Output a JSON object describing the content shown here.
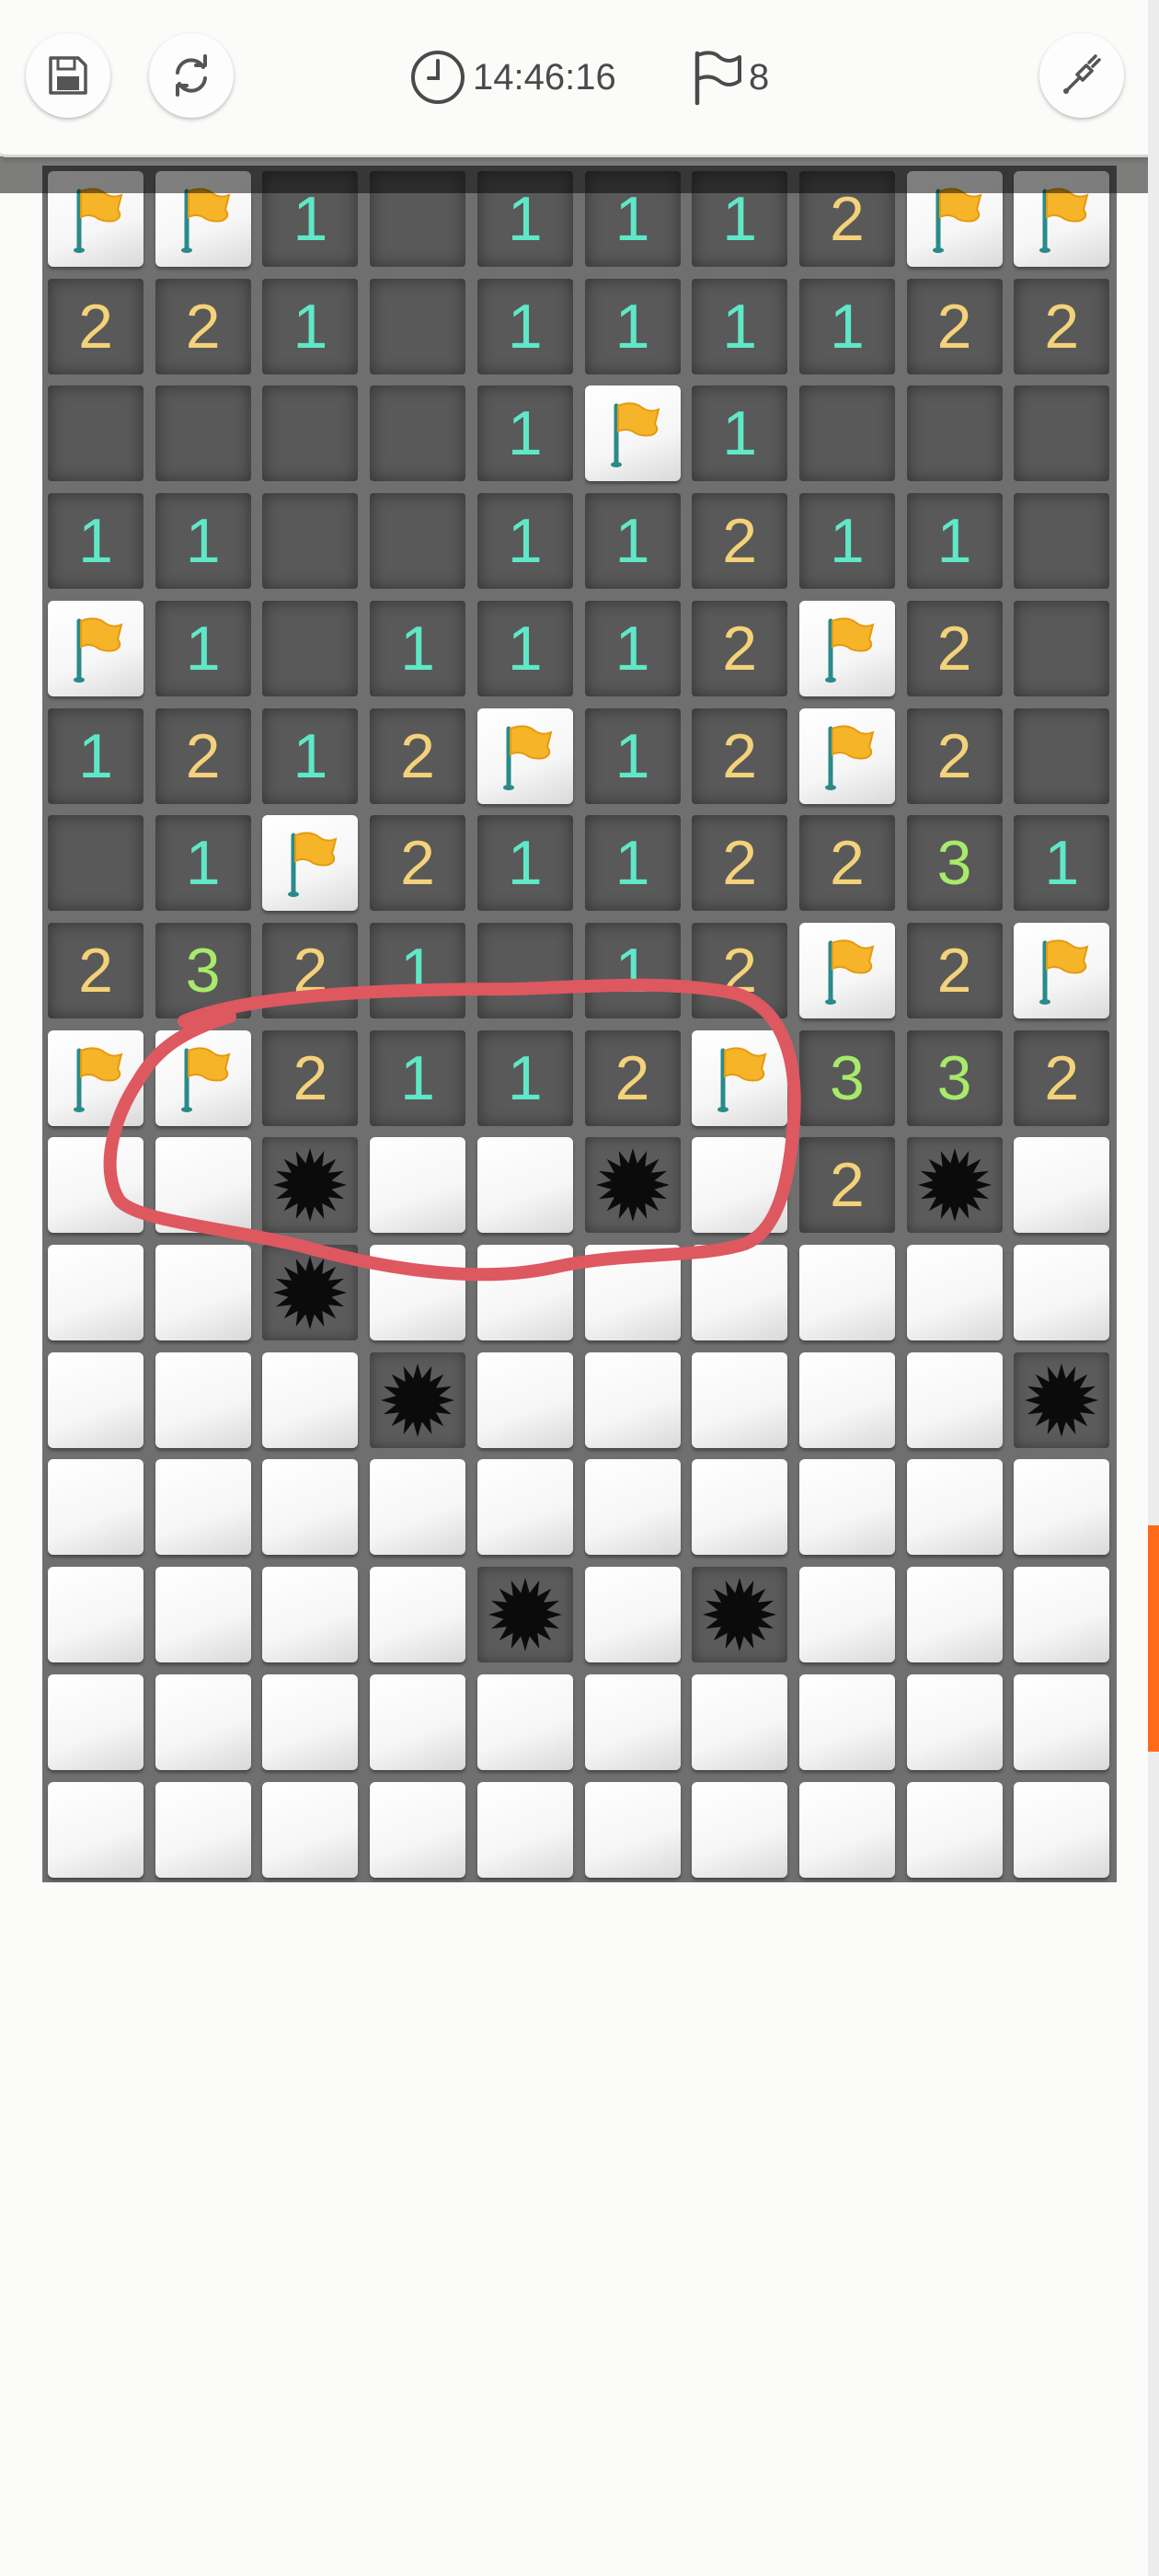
{
  "header": {
    "time": "14:46:16",
    "flags_remaining": "8",
    "buttons": [
      {
        "name": "save-button",
        "icon": "save-icon"
      },
      {
        "name": "restart-button",
        "icon": "refresh-icon"
      },
      {
        "name": "dig-mode-button",
        "icon": "shovel-icon"
      }
    ]
  },
  "colors": {
    "one": "#5fe8c8",
    "two": "#f4d27a",
    "three": "#a8ea6a",
    "flag": "#f6b428",
    "annotation": "#de5860",
    "scroll_thumb": "#ff6a1a"
  },
  "board": {
    "columns": 10,
    "rows": 16,
    "legend": "F = flagged, M = revealed mine, H = hidden, . = empty revealed, digit = adjacent mine count",
    "grid": [
      [
        "F",
        "F",
        "1",
        ".",
        "1",
        "1",
        "1",
        "2",
        "F",
        "F"
      ],
      [
        "2",
        "2",
        "1",
        ".",
        "1",
        "1",
        "1",
        "1",
        "2",
        "2"
      ],
      [
        ".",
        ".",
        ".",
        ".",
        "1",
        "F",
        "1",
        ".",
        ".",
        "."
      ],
      [
        "1",
        "1",
        ".",
        ".",
        "1",
        "1",
        "2",
        "1",
        "1",
        "."
      ],
      [
        "F",
        "1",
        ".",
        "1",
        "1",
        "1",
        "2",
        "F",
        "2",
        "."
      ],
      [
        "1",
        "2",
        "1",
        "2",
        "F",
        "1",
        "2",
        "F",
        "2",
        "."
      ],
      [
        ".",
        "1",
        "F",
        "2",
        "1",
        "1",
        "2",
        "2",
        "3",
        "1"
      ],
      [
        "2",
        "3",
        "2",
        "1",
        ".",
        "1",
        "2",
        "F",
        "2",
        "F"
      ],
      [
        "F",
        "F",
        "2",
        "1",
        "1",
        "2",
        "F",
        "3",
        "3",
        "2"
      ],
      [
        "H",
        "H",
        "M",
        "H",
        "H",
        "M",
        "H",
        "2",
        "M",
        "H"
      ],
      [
        "H",
        "H",
        "M",
        "H",
        "H",
        "H",
        "H",
        "H",
        "H",
        "H"
      ],
      [
        "H",
        "H",
        "H",
        "M",
        "H",
        "H",
        "H",
        "H",
        "H",
        "M"
      ],
      [
        "H",
        "H",
        "H",
        "H",
        "H",
        "H",
        "H",
        "H",
        "H",
        "H"
      ],
      [
        "H",
        "H",
        "H",
        "H",
        "M",
        "H",
        "M",
        "H",
        "H",
        "H"
      ],
      [
        "H",
        "H",
        "H",
        "H",
        "H",
        "H",
        "H",
        "H",
        "H",
        "H"
      ],
      [
        "H",
        "H",
        "H",
        "H",
        "H",
        "H",
        "H",
        "H",
        "H",
        "H"
      ]
    ]
  }
}
